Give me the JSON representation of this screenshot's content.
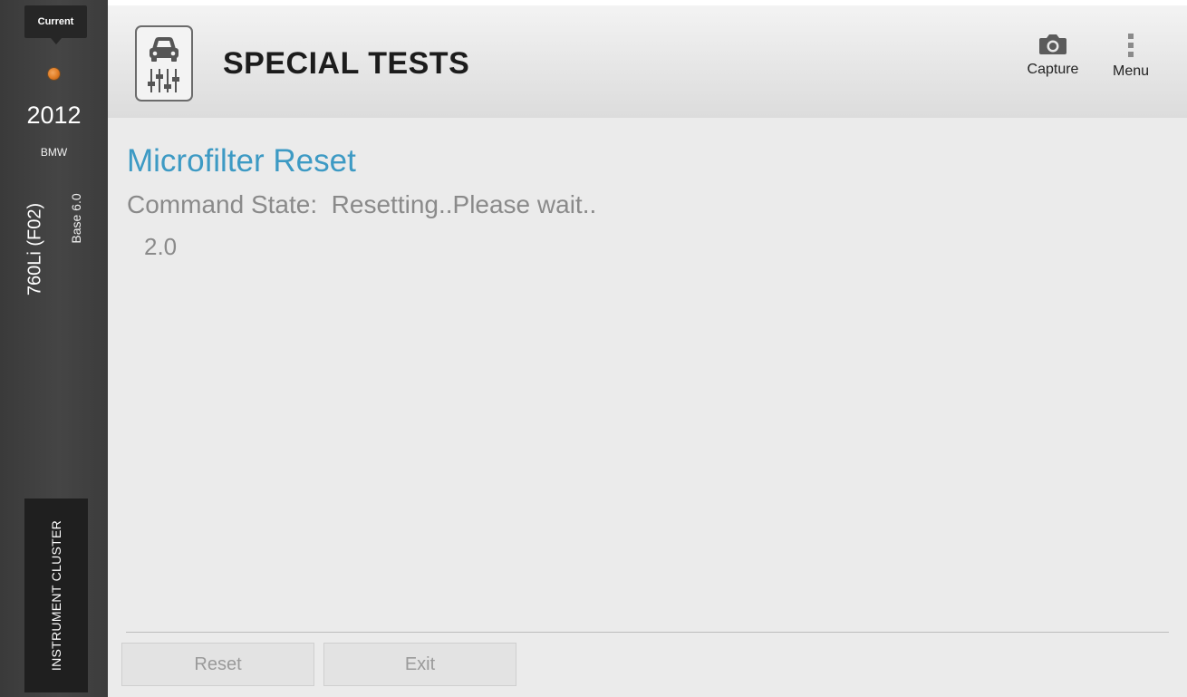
{
  "sidebar": {
    "current_label": "Current",
    "year": "2012",
    "make": "BMW",
    "model": "760Li (F02)",
    "trim": "Base 6.0",
    "module": "INSTRUMENT CLUSTER",
    "status_dot_color": "#e07b23"
  },
  "header": {
    "title": "SPECIAL TESTS",
    "icon": "car-tuning-icon",
    "tools": {
      "capture_label": "Capture",
      "capture_icon": "camera-icon",
      "menu_label": "Menu",
      "menu_icon": "vertical-dots-icon"
    }
  },
  "main": {
    "test_title": "Microfilter Reset",
    "command_state_label": "Command State:",
    "command_state_value": "Resetting..Please wait..",
    "value": "2.0",
    "accent_color": "#3d9ac4"
  },
  "footer": {
    "reset_label": "Reset",
    "exit_label": "Exit"
  }
}
